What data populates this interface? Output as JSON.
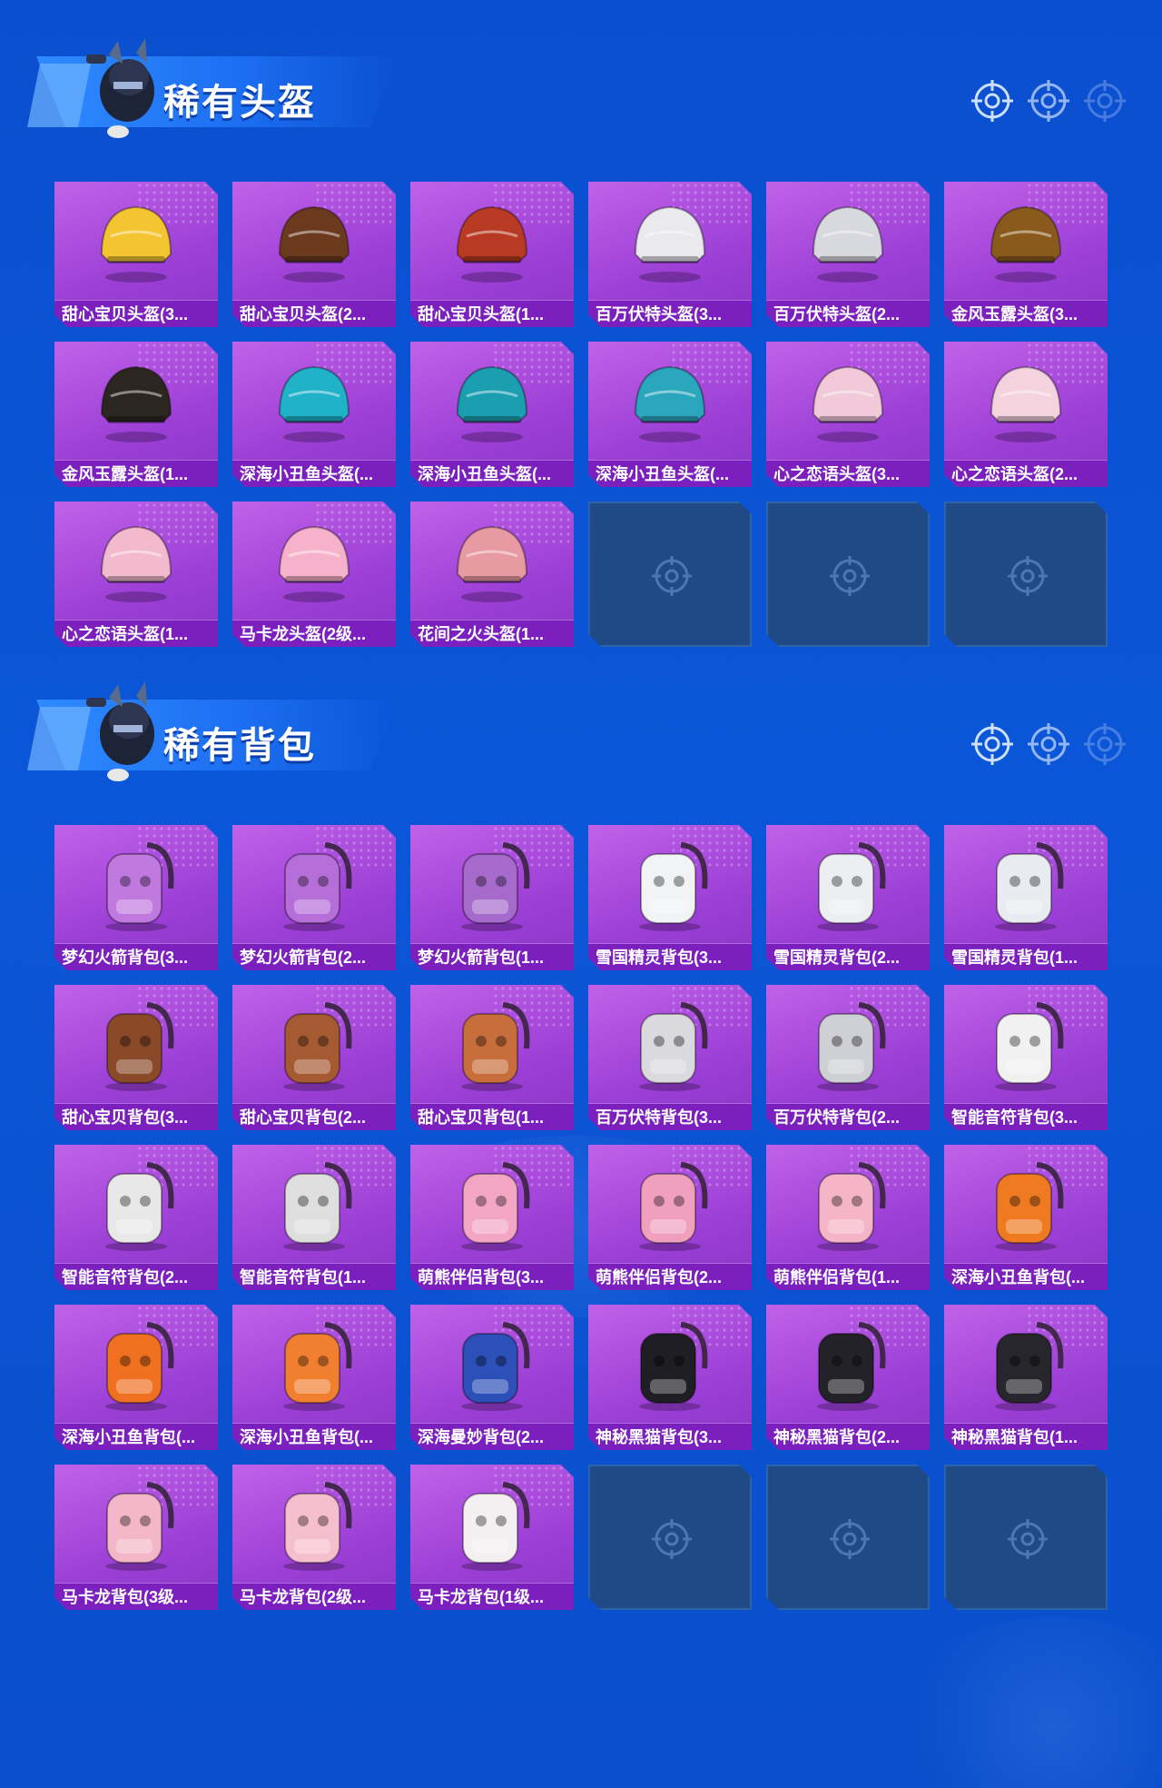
{
  "colors": {
    "background": "#0a4fd0",
    "card_purple": "#a94ae0",
    "label_band": "#7b1fbf",
    "empty_slot": "#1f4a86",
    "title_text": "#ffffff"
  },
  "helmets": {
    "title": "稀有头盔",
    "items": [
      {
        "label": "甜心宝贝头盔(3...",
        "icon": "cupcake-helmet-icon",
        "tint": "#f3c531"
      },
      {
        "label": "甜心宝贝头盔(2...",
        "icon": "chocolate-helmet-icon",
        "tint": "#6b3a1e"
      },
      {
        "label": "甜心宝贝头盔(1...",
        "icon": "red-helmet-icon",
        "tint": "#b83a22"
      },
      {
        "label": "百万伏特头盔(3...",
        "icon": "white-cat-helmet-icon",
        "tint": "#e9e9ee"
      },
      {
        "label": "百万伏特头盔(2...",
        "icon": "white-cat-helmet-icon",
        "tint": "#d8d8df"
      },
      {
        "label": "金风玉露头盔(3...",
        "icon": "gold-plume-helmet-icon",
        "tint": "#8a5a1c"
      },
      {
        "label": "金风玉露头盔(1...",
        "icon": "black-gold-helmet-icon",
        "tint": "#2b2620"
      },
      {
        "label": "深海小丑鱼头盔(...",
        "icon": "teal-visor-helmet-icon",
        "tint": "#1fb2c8"
      },
      {
        "label": "深海小丑鱼头盔(...",
        "icon": "teal-helmet-icon",
        "tint": "#1b9fb0"
      },
      {
        "label": "深海小丑鱼头盔(...",
        "icon": "teal-helmet-icon",
        "tint": "#2aa7bd"
      },
      {
        "label": "心之恋语头盔(3...",
        "icon": "pink-shell-helmet-icon",
        "tint": "#f1c9d8"
      },
      {
        "label": "心之恋语头盔(2...",
        "icon": "pink-shell-helmet-icon",
        "tint": "#f4d2de"
      },
      {
        "label": "心之恋语头盔(1...",
        "icon": "pink-open-helmet-icon",
        "tint": "#f3b9cc"
      },
      {
        "label": "马卡龙头盔(2级...",
        "icon": "pink-bunny-helmet-icon",
        "tint": "#f7b2cb"
      },
      {
        "label": "花间之火头盔(1...",
        "icon": "pink-gold-helmet-icon",
        "tint": "#e79aa2"
      }
    ],
    "empty_slots": 3
  },
  "backpacks": {
    "title": "稀有背包",
    "items": [
      {
        "label": "梦幻火箭背包(3...",
        "icon": "rocket-backpack-icon",
        "tint": "#c07adf"
      },
      {
        "label": "梦幻火箭背包(2...",
        "icon": "rocket-backpack-icon",
        "tint": "#b66fd8"
      },
      {
        "label": "梦幻火箭背包(1...",
        "icon": "rocket-backpack-icon",
        "tint": "#a56acb"
      },
      {
        "label": "雪国精灵背包(3...",
        "icon": "snowman-backpack-icon",
        "tint": "#f1f3f5"
      },
      {
        "label": "雪国精灵背包(2...",
        "icon": "snowman-backpack-icon",
        "tint": "#eceef2"
      },
      {
        "label": "雪国精灵背包(1...",
        "icon": "bunny-snowman-backpack-icon",
        "tint": "#e8ebf0"
      },
      {
        "label": "甜心宝贝背包(3...",
        "icon": "cake-backpack-icon",
        "tint": "#8a4a2a"
      },
      {
        "label": "甜心宝贝背包(2...",
        "icon": "cake-backpack-icon",
        "tint": "#a55a32"
      },
      {
        "label": "甜心宝贝背包(1...",
        "icon": "cake-backpack-icon",
        "tint": "#c86e3c"
      },
      {
        "label": "百万伏特背包(3...",
        "icon": "cat-backpack-icon",
        "tint": "#d9d9de"
      },
      {
        "label": "百万伏特背包(2...",
        "icon": "cat-backpack-icon",
        "tint": "#cfd0d6"
      },
      {
        "label": "智能音符背包(3...",
        "icon": "white-orange-backpack-icon",
        "tint": "#f1f1f1"
      },
      {
        "label": "智能音符背包(2...",
        "icon": "white-orange-backpack-icon",
        "tint": "#e8e8e8"
      },
      {
        "label": "智能音符背包(1...",
        "icon": "white-orange-backpack-icon",
        "tint": "#dedede"
      },
      {
        "label": "萌熊伴侣背包(3...",
        "icon": "pink-bear-backpack-icon",
        "tint": "#f3a6c3"
      },
      {
        "label": "萌熊伴侣背包(2...",
        "icon": "pink-bear-backpack-icon",
        "tint": "#f0a0bd"
      },
      {
        "label": "萌熊伴侣背包(1...",
        "icon": "pink-bear-backpack-icon",
        "tint": "#f5b4c8"
      },
      {
        "label": "深海小丑鱼背包(...",
        "icon": "clownfish-backpack-icon",
        "tint": "#f07a22"
      },
      {
        "label": "深海小丑鱼背包(...",
        "icon": "clownfish-backpack-icon",
        "tint": "#ef7020"
      },
      {
        "label": "深海小丑鱼背包(...",
        "icon": "clownfish-backpack-icon",
        "tint": "#f08030"
      },
      {
        "label": "深海曼妙背包(2...",
        "icon": "blue-capsule-backpack-icon",
        "tint": "#2d4fb8"
      },
      {
        "label": "神秘黑猫背包(3...",
        "icon": "black-cat-backpack-icon",
        "tint": "#1e1e24"
      },
      {
        "label": "神秘黑猫背包(2...",
        "icon": "black-cat-backpack-icon",
        "tint": "#222228"
      },
      {
        "label": "神秘黑猫背包(1...",
        "icon": "black-cat-backpack-icon",
        "tint": "#26262c"
      },
      {
        "label": "马卡龙背包(3级...",
        "icon": "macaron-backpack-icon",
        "tint": "#f4b7c9"
      },
      {
        "label": "马卡龙背包(2级...",
        "icon": "macaron-backpack-icon",
        "tint": "#f6bfd0"
      },
      {
        "label": "马卡龙背包(1级...",
        "icon": "macaron-backpack-icon",
        "tint": "#f4f0f2"
      }
    ],
    "empty_slots": 3
  }
}
